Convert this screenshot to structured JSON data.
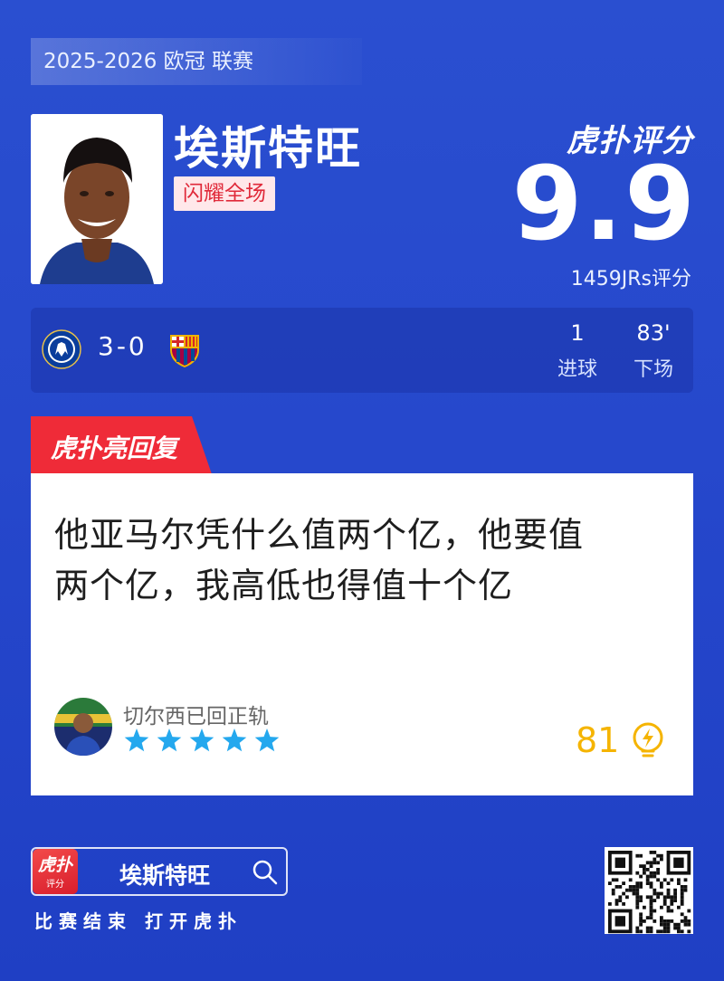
{
  "header": {
    "season": "2025-2026 欧冠 联赛"
  },
  "player": {
    "name": "埃斯特旺",
    "badge": "闪耀全场"
  },
  "rating": {
    "brand": "虎扑评分",
    "score": "9.9",
    "raters": "1459JRs评分"
  },
  "match": {
    "score": "3-0",
    "home_team": "Chelsea",
    "away_team": "FC Barcelona",
    "stats": [
      {
        "value": "1",
        "label": "进球"
      },
      {
        "value": "83'",
        "label": "下场"
      }
    ]
  },
  "reply": {
    "tab_label": "虎扑亮回复",
    "line1": "他亚马尔凭什么值两个亿，他要值",
    "line2": "两个亿，我高低也得值十个亿",
    "username": "切尔西已回正轨",
    "stars": 5,
    "likes": "81"
  },
  "footer": {
    "app_icon_top": "虎扑",
    "app_icon_bottom": "评分",
    "search_text": "埃斯特旺",
    "tagline": "比赛结束 打开虎扑"
  },
  "colors": {
    "background": "#2648cc",
    "accent_red": "#e02a3a",
    "star_blue": "#24a8ee",
    "like_yellow": "#f5b400"
  }
}
